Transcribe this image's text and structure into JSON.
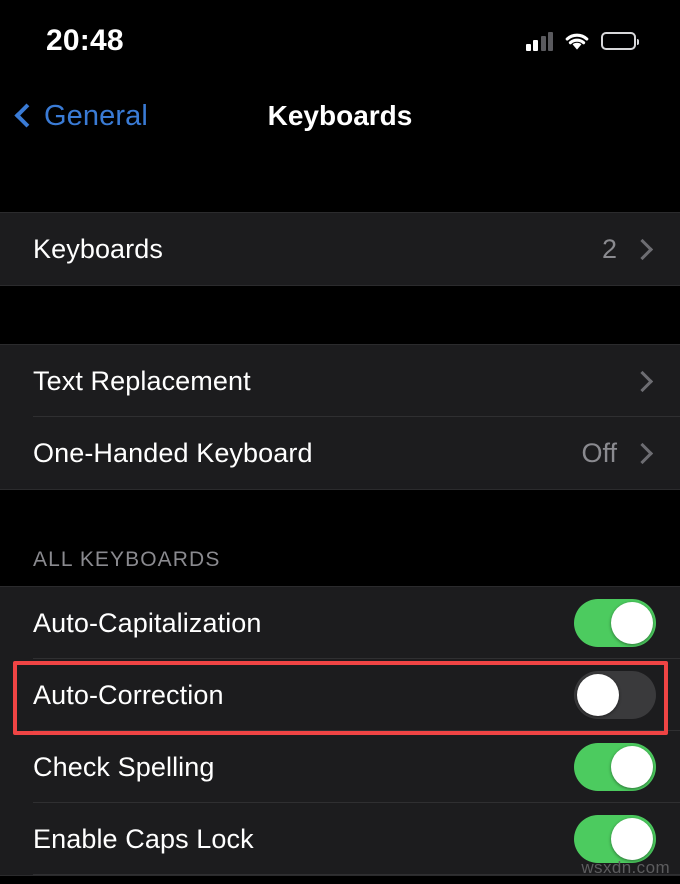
{
  "status_bar": {
    "time": "20:48",
    "signal_icon": "cellular-signal-icon",
    "signal_bars_filled": 2,
    "signal_bars_total": 4,
    "wifi_icon": "wifi-icon",
    "battery_icon": "battery-icon"
  },
  "nav": {
    "back_icon": "chevron-left-icon",
    "back_label": "General",
    "title": "Keyboards"
  },
  "colors": {
    "page_background": "#000000",
    "row_background": "#1C1C1E",
    "accent_blue": "#3A7BD5",
    "toggle_on_green": "#4CCB5F",
    "toggle_off_grey": "#3A3A3C",
    "secondary_text": "#8A8A8F",
    "annotation_red": "#EF4444"
  },
  "groups": [
    {
      "id": "group-keyboards",
      "rows": [
        {
          "label": "Keyboards",
          "value": "2",
          "accessory": "chevron-right-icon"
        }
      ]
    },
    {
      "id": "group-text",
      "rows": [
        {
          "label": "Text Replacement",
          "value": "",
          "accessory": "chevron-right-icon"
        },
        {
          "label": "One-Handed Keyboard",
          "value": "Off",
          "accessory": "chevron-right-icon"
        }
      ]
    }
  ],
  "section_all_keyboards": {
    "header": "ALL KEYBOARDS",
    "rows": [
      {
        "label": "Auto-Capitalization",
        "toggle": "on",
        "highlighted": false
      },
      {
        "label": "Auto-Correction",
        "toggle": "off",
        "highlighted": true
      },
      {
        "label": "Check Spelling",
        "toggle": "on",
        "highlighted": false
      },
      {
        "label": "Enable Caps Lock",
        "toggle": "on",
        "highlighted": false
      }
    ]
  },
  "annotation": {
    "target_row": "Auto-Correction",
    "shape": "rectangle",
    "color": "#EF4444"
  },
  "watermark": {
    "text": "wsxdn.com"
  }
}
